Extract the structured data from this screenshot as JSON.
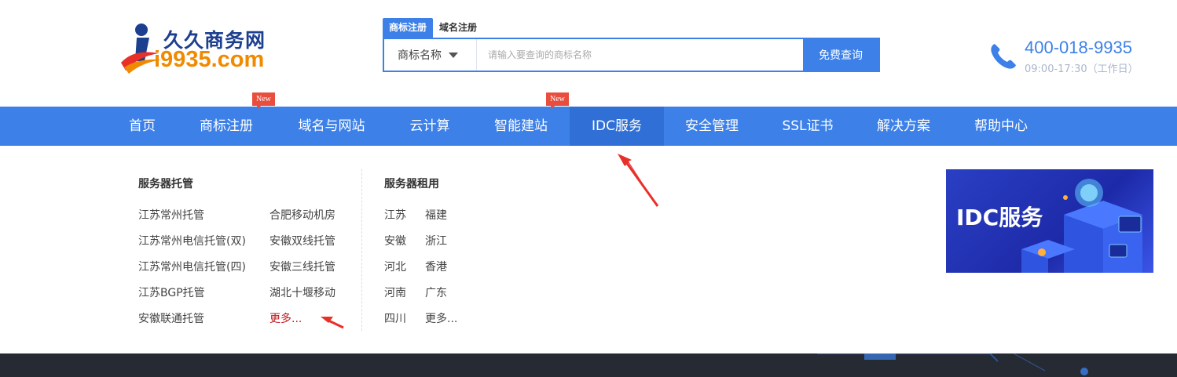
{
  "logo": {
    "cn": "久久商务网",
    "en": "i9935.com"
  },
  "search": {
    "tabs": [
      {
        "label": "商标注册",
        "active": true
      },
      {
        "label": "域名注册",
        "active": false
      }
    ],
    "select_value": "商标名称",
    "placeholder": "请输入要查询的商标名称",
    "button": "免费查询"
  },
  "contact": {
    "phone": "400-018-9935",
    "hours": "09:00-17:30（工作日）"
  },
  "nav": [
    {
      "label": "首页"
    },
    {
      "label": "商标注册",
      "badge": "New"
    },
    {
      "label": "域名与网站"
    },
    {
      "label": "云计算"
    },
    {
      "label": "智能建站",
      "badge": "New"
    },
    {
      "label": "IDC服务",
      "active": true
    },
    {
      "label": "安全管理"
    },
    {
      "label": "SSL证书"
    },
    {
      "label": "解决方案"
    },
    {
      "label": "帮助中心"
    }
  ],
  "dropdown": {
    "hosting": {
      "title": "服务器托管",
      "col1": [
        "江苏常州托管",
        "江苏常州电信托管(双)",
        "江苏常州电信托管(四)",
        "江苏BGP托管",
        "安徽联通托管"
      ],
      "col2": [
        "合肥移动机房",
        "安徽双线托管",
        "安徽三线托管",
        "湖北十堰移动",
        "更多..."
      ]
    },
    "rental": {
      "title": "服务器租用",
      "col1": [
        "江苏",
        "安徽",
        "河北",
        "河南",
        "四川"
      ],
      "col2": [
        "福建",
        "浙江",
        "香港",
        "广东",
        "更多..."
      ]
    },
    "banner_text": "IDC服务"
  },
  "colors": {
    "primary": "#3c80e8",
    "nav_active": "#2f6fd6",
    "badge": "#e84d3d",
    "more_link": "#c0161e",
    "annotation": "#e8302a"
  }
}
